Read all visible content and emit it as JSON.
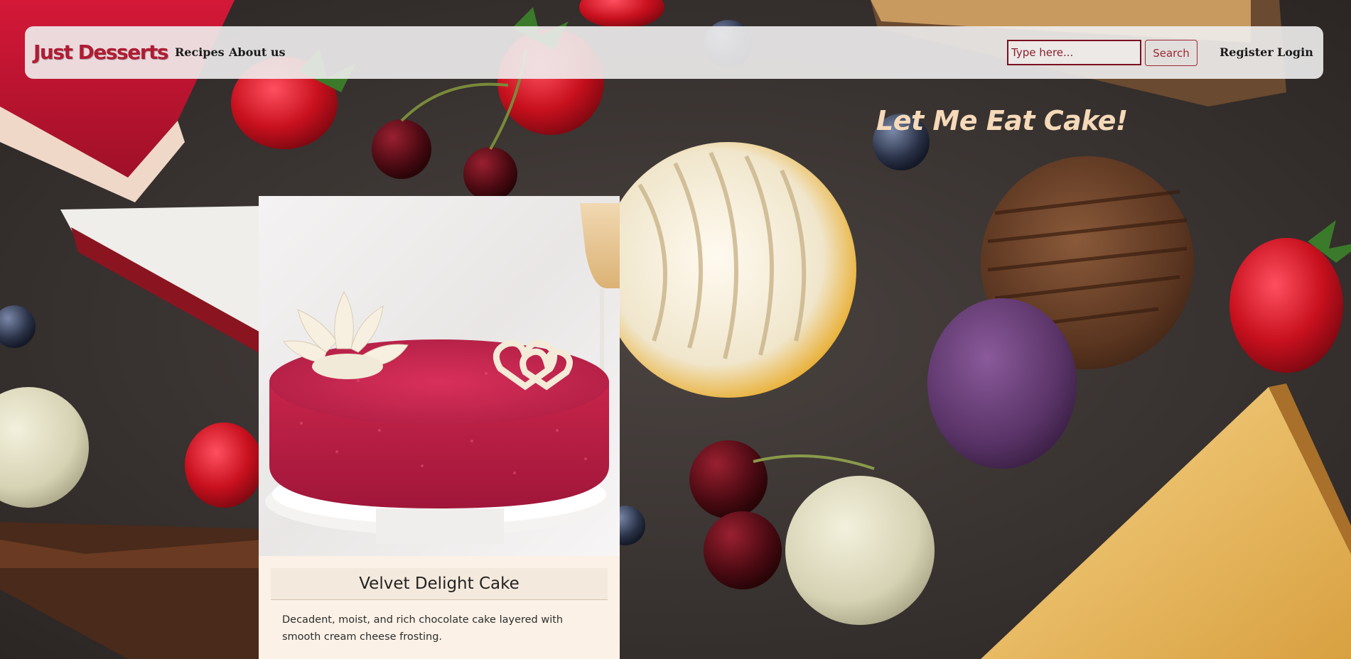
{
  "site": {
    "brand": "Just Desserts"
  },
  "nav": {
    "links": [
      {
        "label": "Recipes"
      },
      {
        "label": "About us"
      }
    ],
    "search": {
      "placeholder": "Type here...",
      "button_label": "Search"
    },
    "auth": {
      "register_label": "Register",
      "login_label": "Login"
    }
  },
  "hero": {
    "title": "Let Me Eat Cake!"
  },
  "featured_card": {
    "title": "Velvet Delight Cake",
    "description": "Decadent, moist, and rich chocolate cake layered with smooth cream cheese frosting."
  },
  "colors": {
    "brand_red": "#b01c33",
    "hero_text": "#f5d9b8",
    "card_bg": "#fbf1e6",
    "search_border": "#7a1020"
  }
}
